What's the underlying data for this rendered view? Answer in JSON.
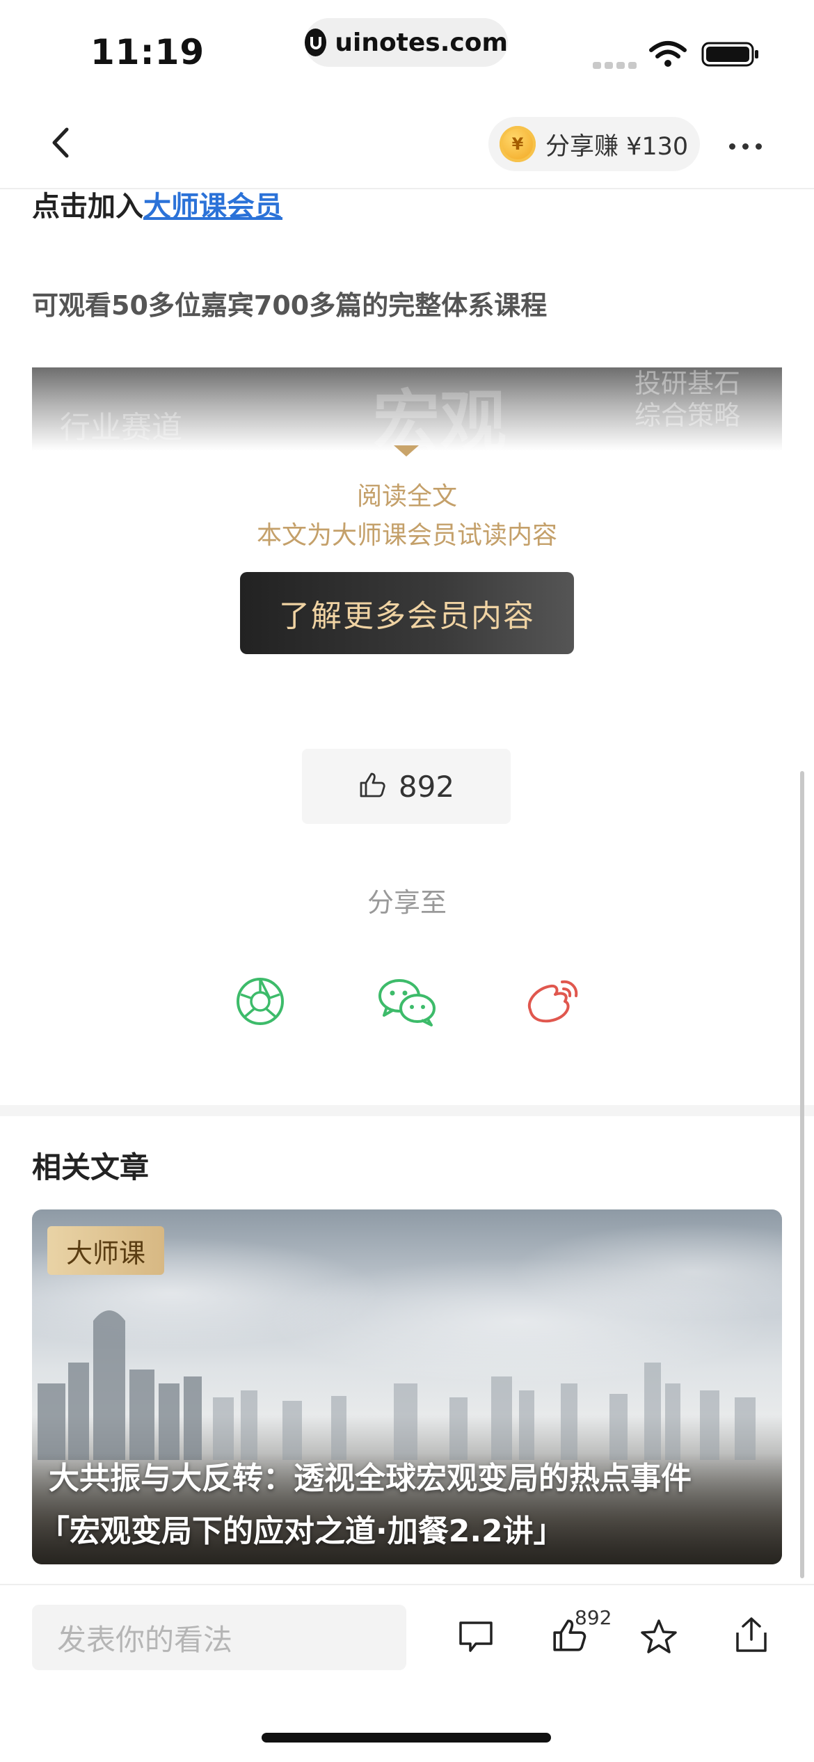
{
  "status_bar": {
    "time": "11:19",
    "url": "uinotes.com"
  },
  "nav": {
    "share_earn": "分享赚 ¥130",
    "coin_symbol": "¥"
  },
  "article": {
    "join_prefix": "点击加入",
    "join_link": "大师课会员",
    "description": "可观看50多位嘉宾700多篇的完整体系课程",
    "banner_text_left": "行业赛道",
    "banner_text_center": "宏观",
    "banner_text_right_1": "投研基石",
    "banner_text_right_2": "综合策略"
  },
  "paywall": {
    "read_full": "阅读全文",
    "trial_note": "本文为大师课会员试读内容",
    "member_button": "了解更多会员内容"
  },
  "like": {
    "count": "892"
  },
  "share": {
    "label": "分享至",
    "targets": [
      "moments-icon",
      "wechat-icon",
      "weibo-icon"
    ]
  },
  "related": {
    "title": "相关文章",
    "card": {
      "badge": "大师课",
      "title_line1": "大共振与大反转：透视全球宏观变局的热点事件",
      "title_line2": "「宏观变局下的应对之道·加餐2.2讲」"
    }
  },
  "bottom_bar": {
    "comment_placeholder": "发表你的看法",
    "like_count": "892",
    "icons": [
      "comment-icon",
      "thumb-up-icon",
      "star-icon",
      "share-icon"
    ]
  },
  "colors": {
    "link": "#2b72d8",
    "gold_text": "#c4a06a",
    "share_green": "#3dbb6a",
    "weibo_red": "#e0574e"
  }
}
